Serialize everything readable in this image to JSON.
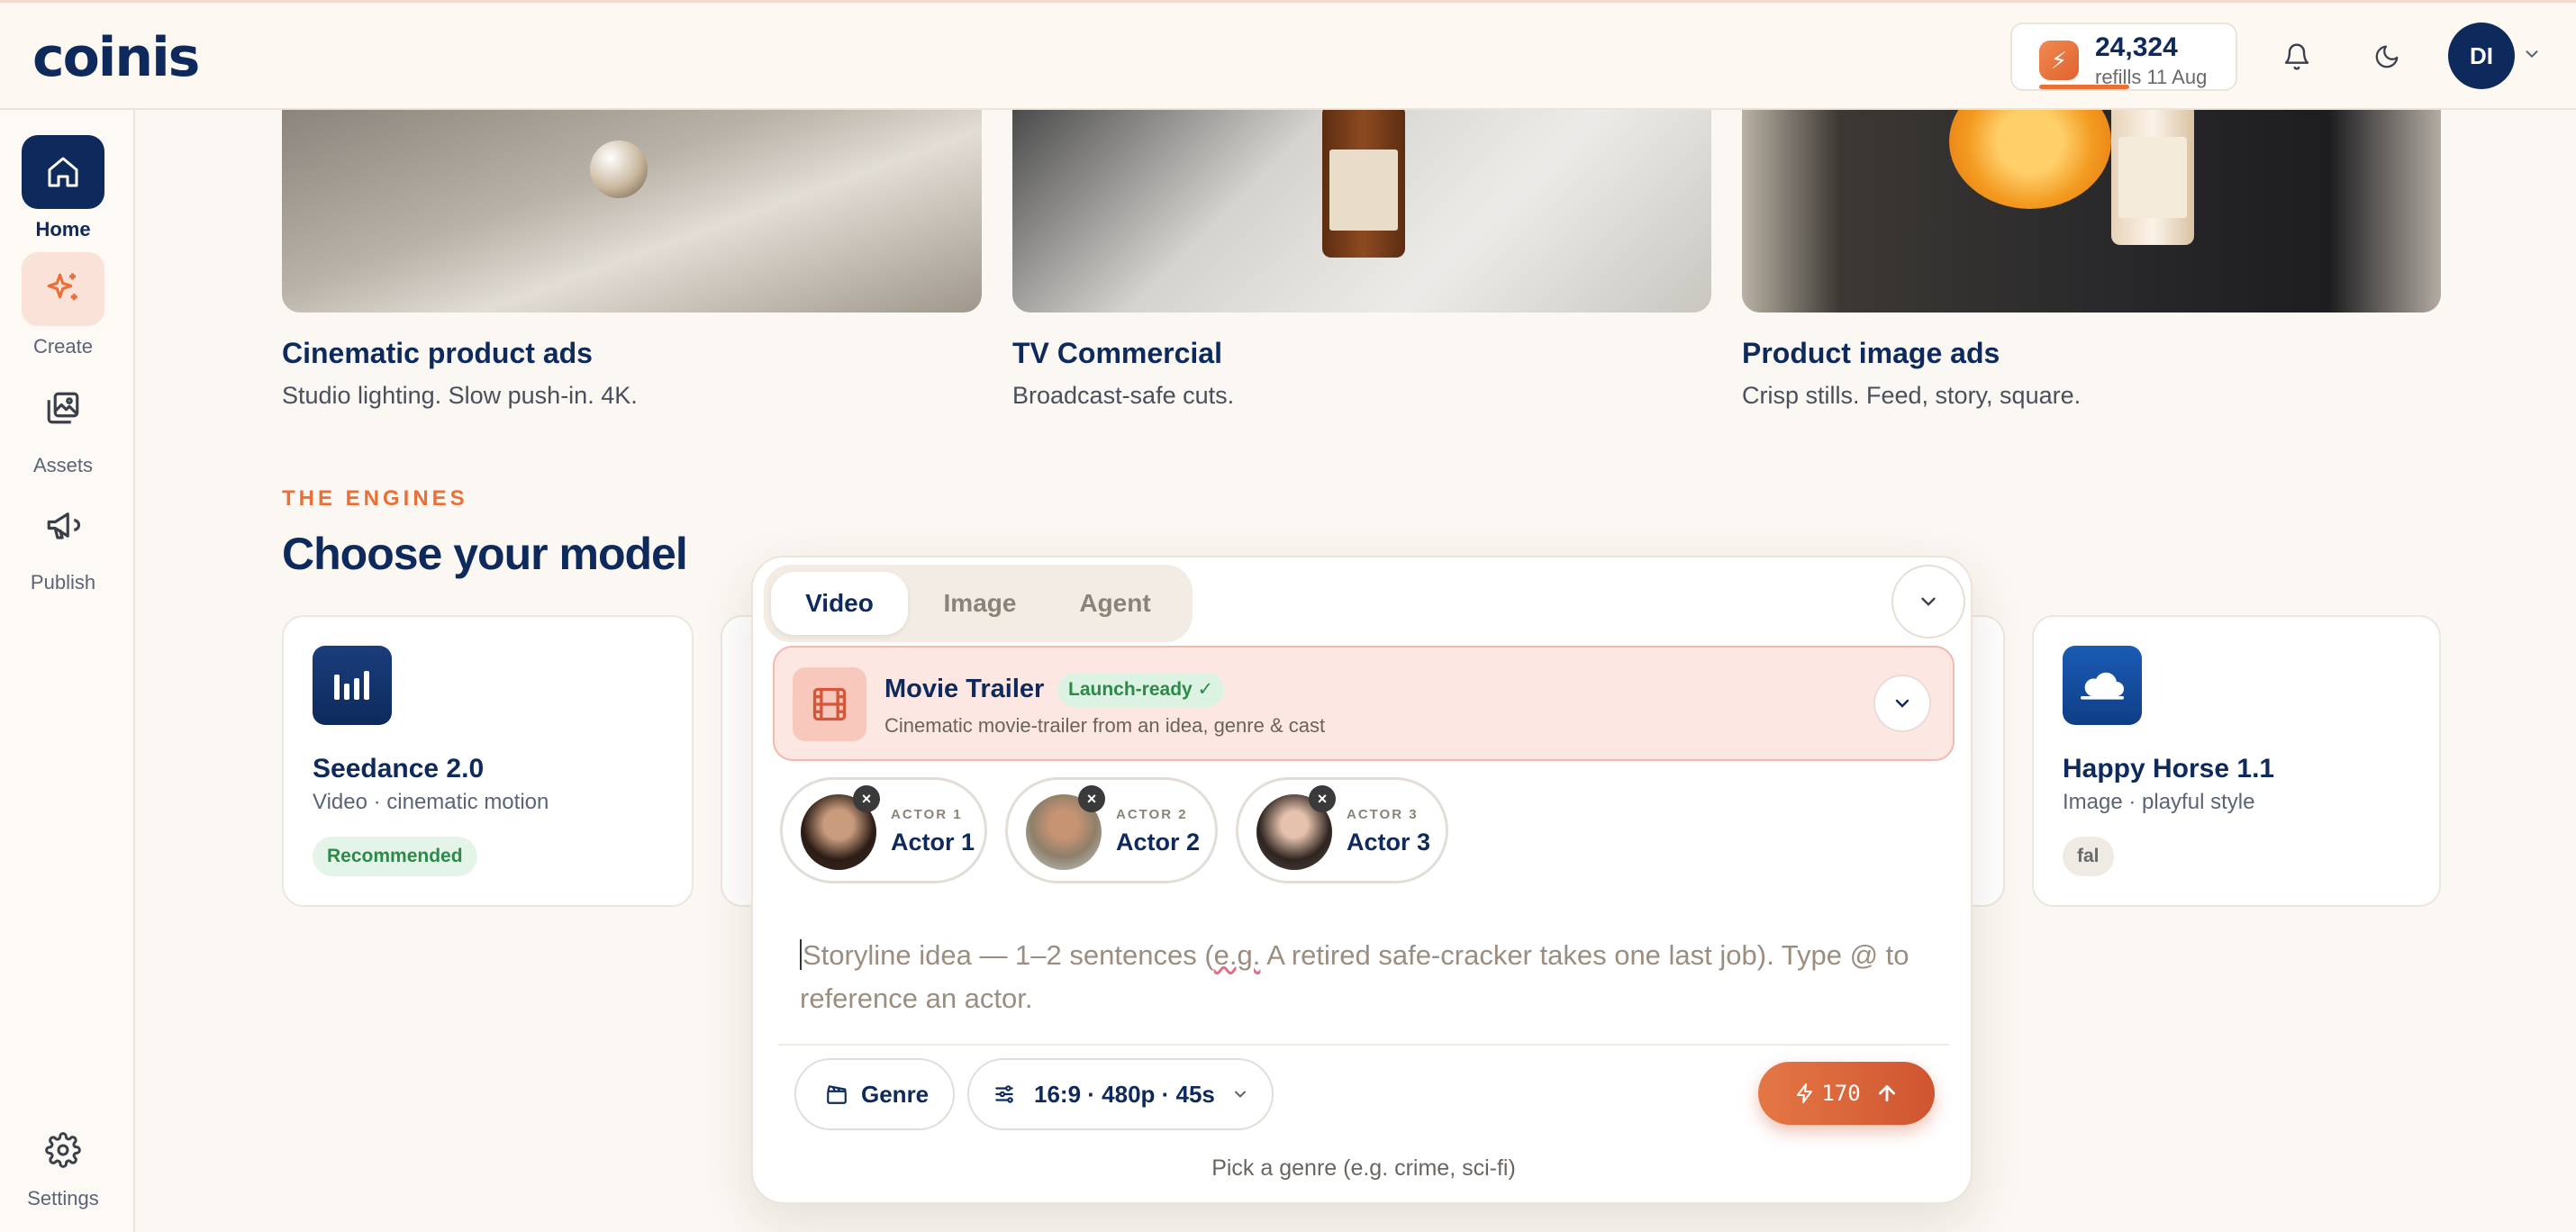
{
  "app": {
    "logo": "coinis"
  },
  "header": {
    "credits_amount": "24,324",
    "credits_refill": "refills 11 Aug",
    "user_initials": "DI"
  },
  "sidebar": {
    "items": [
      {
        "label": "Home",
        "icon": "home-icon",
        "active": true
      },
      {
        "label": "Create",
        "icon": "sparkle-icon"
      },
      {
        "label": "Assets",
        "icon": "images-icon"
      },
      {
        "label": "Publish",
        "icon": "megaphone-icon"
      }
    ],
    "settings_label": "Settings"
  },
  "templates": [
    {
      "title": "Cinematic product ads",
      "desc": "Studio lighting. Slow push-in. 4K."
    },
    {
      "title": "TV Commercial",
      "desc": "Broadcast-safe cuts."
    },
    {
      "title": "Product image ads",
      "desc": "Crisp stills. Feed, story, square."
    }
  ],
  "engines": {
    "eyebrow": "THE ENGINES",
    "title": "Choose your model",
    "models": [
      {
        "name": "Seedance 2.0",
        "sub": "Video · cinematic motion",
        "tag": "Recommended"
      },
      {
        "name": "Happy Horse 1.1",
        "sub": "Image · playful style",
        "tag": "fal"
      }
    ]
  },
  "composer": {
    "tabs": [
      "Video",
      "Image",
      "Agent"
    ],
    "active_tab": "Video",
    "template": {
      "title": "Movie Trailer",
      "badge": "Launch-ready ✓",
      "desc": "Cinematic movie-trailer from an idea, genre & cast"
    },
    "actors": [
      {
        "kicker": "ACTOR 1",
        "name": "Actor 1"
      },
      {
        "kicker": "ACTOR 2",
        "name": "Actor 2"
      },
      {
        "kicker": "ACTOR 3",
        "name": "Actor 3"
      }
    ],
    "placeholder_a": "Storyline idea — 1–2 sentences (",
    "placeholder_eg": "e.g.",
    "placeholder_b": " A retired safe-cracker takes one last job). Type @ to reference an actor.",
    "genre_label": "Genre",
    "settings_label": "16:9 · 480p · 45s",
    "cost": "170",
    "hint": "Pick a genre (e.g. crime, sci-fi)"
  },
  "colors": {
    "brand_navy": "#0e2a5c",
    "accent_orange": "#ec6f35",
    "success_green": "#2c8a48"
  }
}
